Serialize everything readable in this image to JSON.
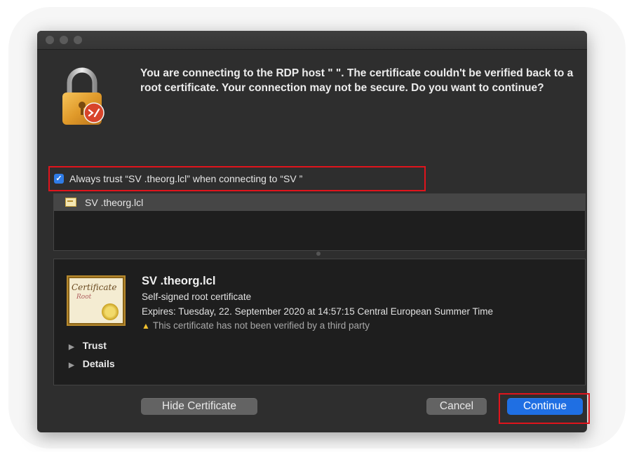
{
  "dialog": {
    "message": "You are connecting to the RDP host \"            \". The certificate couldn't be verified back to a root certificate. Your connection may not be secure. Do you want to continue?"
  },
  "trust_option": {
    "checked": true,
    "label": "Always trust “SV         .theorg.lcl” when connecting to “SV          ”"
  },
  "cert_list": {
    "items": [
      {
        "name": "SV         .theorg.lcl"
      }
    ]
  },
  "certificate": {
    "name": "SV         .theorg.lcl",
    "type": "Self-signed root certificate",
    "expires": "Expires: Tuesday, 22. September 2020 at 14:57:15 Central European Summer Time",
    "warning": "This certificate has not been verified by a third party",
    "image_text_main": "Certificate",
    "image_text_sub": "Root"
  },
  "sections": {
    "trust_label": "Trust",
    "details_label": "Details"
  },
  "buttons": {
    "hide_certificate": "Hide Certificate",
    "cancel": "Cancel",
    "continue": "Continue"
  },
  "icons": {
    "lock": "lock-icon",
    "remote_desktop_badge": "remote-desktop-icon",
    "checkmark": "checkmark-icon",
    "warning": "warning-icon",
    "disclosure": "disclosure-triangle-icon"
  },
  "colors": {
    "accent": "#1f6fe3",
    "highlight_border": "#e0141c",
    "warning": "#f2c12e",
    "window_bg": "#2e2e2e"
  }
}
